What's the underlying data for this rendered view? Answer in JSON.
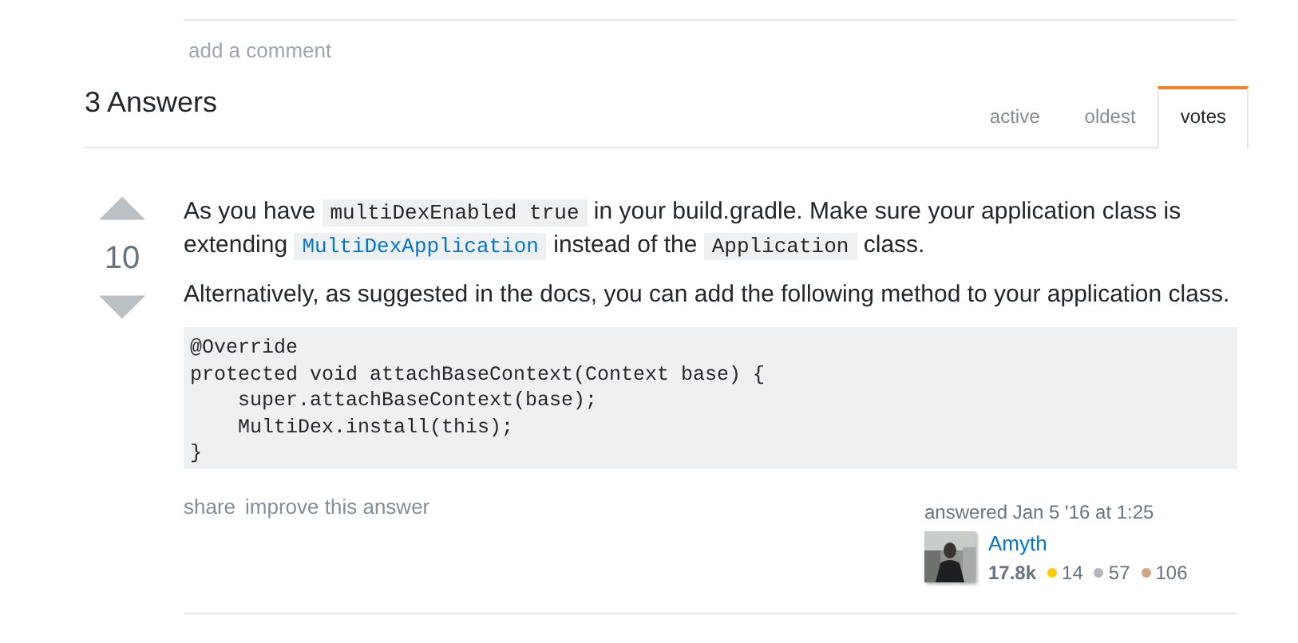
{
  "comments": {
    "add_link": "add a comment"
  },
  "answers_header": {
    "title": "3 Answers",
    "tabs": [
      {
        "label": "active",
        "selected": false
      },
      {
        "label": "oldest",
        "selected": false
      },
      {
        "label": "votes",
        "selected": true
      }
    ]
  },
  "answer": {
    "votes": "10",
    "paragraphs": [
      [
        {
          "kind": "text",
          "text": "As you have "
        },
        {
          "kind": "code",
          "text": "multiDexEnabled true"
        },
        {
          "kind": "text",
          "text": " in your build.gradle. Make sure your application class is extending "
        },
        {
          "kind": "code_link",
          "text": "MultiDexApplication"
        },
        {
          "kind": "text",
          "text": " instead of the "
        },
        {
          "kind": "code",
          "text": "Application"
        },
        {
          "kind": "text",
          "text": " class."
        }
      ],
      [
        {
          "kind": "text",
          "text": "Alternatively, as suggested in the docs, you can add the following method to your application class."
        }
      ]
    ],
    "code": [
      "@Override",
      "protected void attachBaseContext(Context base) {",
      "    super.attachBaseContext(base);",
      "    MultiDex.install(this);",
      "}"
    ],
    "actions": [
      "share",
      "improve this answer"
    ],
    "signature": {
      "action": "answered Jan 5 '16 at 1:25",
      "user": "Amyth",
      "reputation": "17.8k",
      "badges": [
        {
          "count": "14",
          "color": "#ffcc01"
        },
        {
          "count": "57",
          "color": "#b4b8bc"
        },
        {
          "count": "106",
          "color": "#d1a684"
        }
      ]
    }
  }
}
